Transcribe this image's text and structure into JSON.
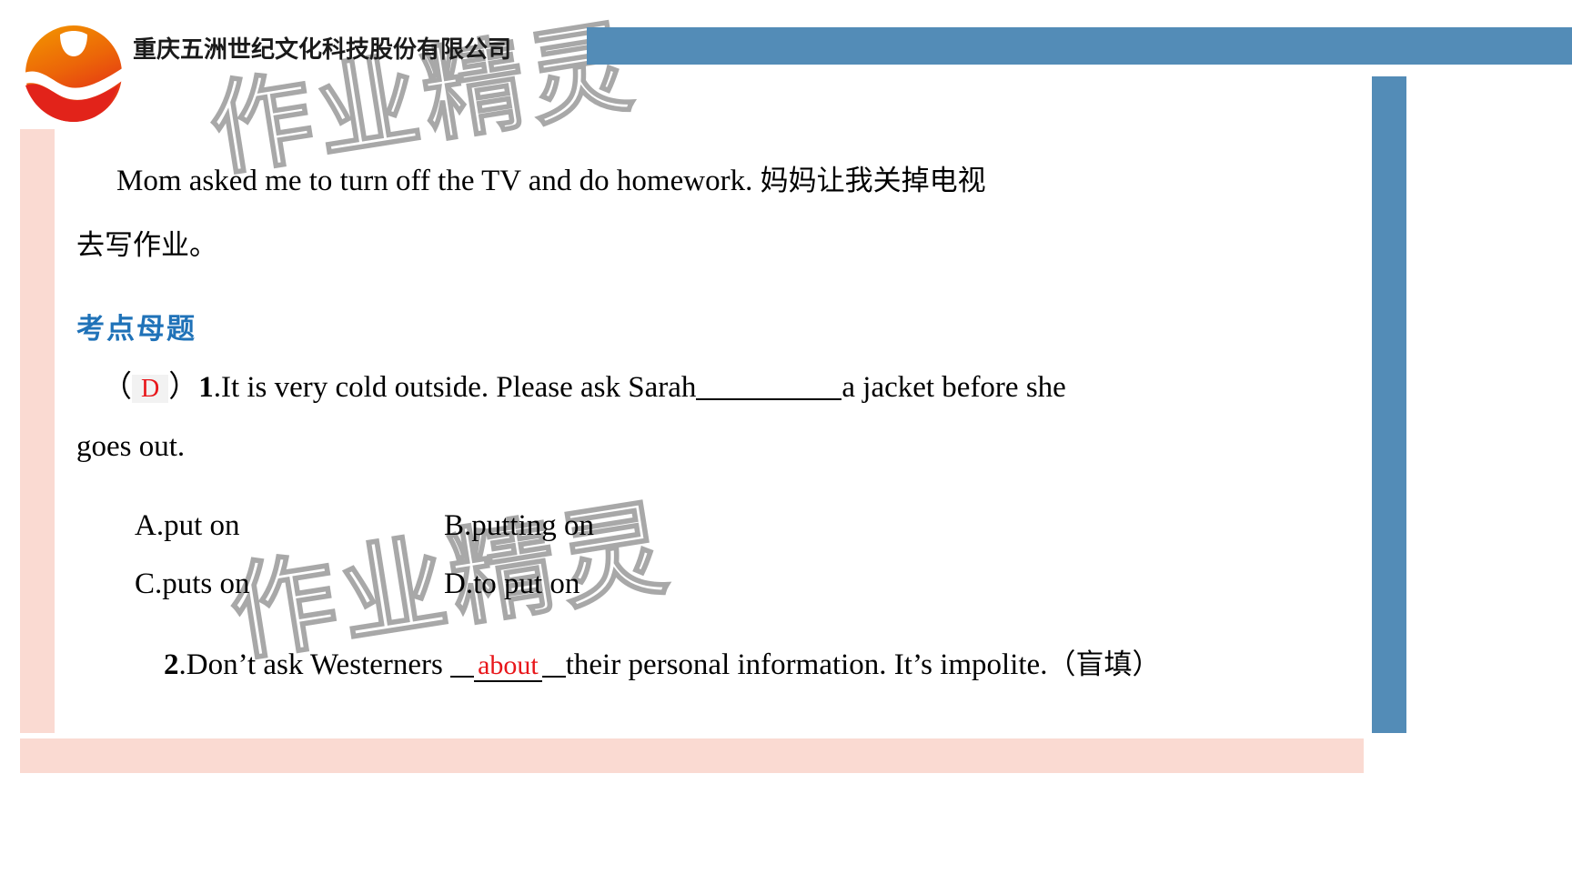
{
  "header": {
    "company_name": "重庆五洲世纪文化科技股份有限公司",
    "logo_icon": "sun-wave-circle-logo",
    "bar_color": "#538cb7"
  },
  "watermark": {
    "text": "作业精灵",
    "color": "#a8a8a8"
  },
  "decor": {
    "pink_color": "#fadad2",
    "blue_color": "#538cb7"
  },
  "content": {
    "example_sentence_en": "Mom asked me to turn off the TV and do homework.",
    "example_sentence_cn_line1": "妈妈让我关掉电视",
    "example_sentence_cn_line2": "去写作业。",
    "section_heading": "考点母题"
  },
  "question1": {
    "paren_open": "（",
    "answer": "D",
    "paren_close": "）",
    "number": "1",
    "number_dot": ".",
    "text_part1": "It is very cold outside. Please ask Sarah",
    "text_part2": "a jacket before she",
    "text_line2": "goes out.",
    "options": [
      {
        "label": "A.put on"
      },
      {
        "label": "B.putting on"
      },
      {
        "label": "C.puts on"
      },
      {
        "label": "D.to put on"
      }
    ]
  },
  "question2": {
    "number": "2",
    "number_dot": ".",
    "text_part1": "Don’t ask Westerners",
    "answer": "about",
    "text_part2": "their personal information. It’s impolite.",
    "tag": "（盲填）"
  },
  "colors": {
    "answer_red": "#e8161a",
    "heading_blue": "#1f72b8"
  }
}
